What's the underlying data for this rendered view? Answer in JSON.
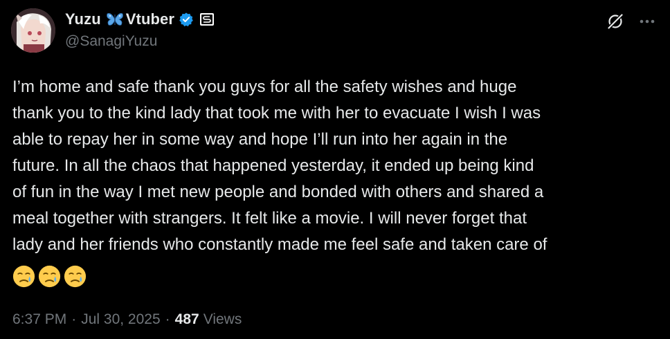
{
  "author": {
    "display_name_prefix": "Yuzu",
    "display_name_suffix": "Vtuber",
    "handle": "@SanagiYuzu",
    "avatar_icon": "anime-avatar",
    "name_emoji": "butterfly-icon",
    "verified_icon": "verified-badge-icon",
    "affiliate_icon": "affiliate-badge-icon"
  },
  "actions": {
    "grok_icon": "grok-icon",
    "more_icon": "more-horizontal-icon"
  },
  "tweet": {
    "text": "I’m home and safe thank you guys for all the safety wishes and huge\nthank you to the kind lady that took me with her to evacuate I wish I was\nable to repay her in some way and hope I’ll run into her again in the\nfuture. In all the chaos that happened yesterday, it ended up being kind\nof fun in the way I met new people and bonded with others and shared a\nmeal together with strangers. It felt like a movie. I will never forget that\nlady and her friends who constantly made me feel safe and taken care of",
    "emojis": [
      "crying-face-emoji",
      "crying-face-emoji",
      "crying-face-emoji"
    ]
  },
  "meta": {
    "time": "6:37 PM",
    "separator": "·",
    "date": "Jul 30, 2025",
    "views_count": "487",
    "views_label": "Views"
  },
  "colors": {
    "background": "#000000",
    "text_primary": "#e7e9ea",
    "text_secondary": "#71767b",
    "verified_blue": "#1d9bf0",
    "butterfly_blue": "#5aa6e8"
  }
}
